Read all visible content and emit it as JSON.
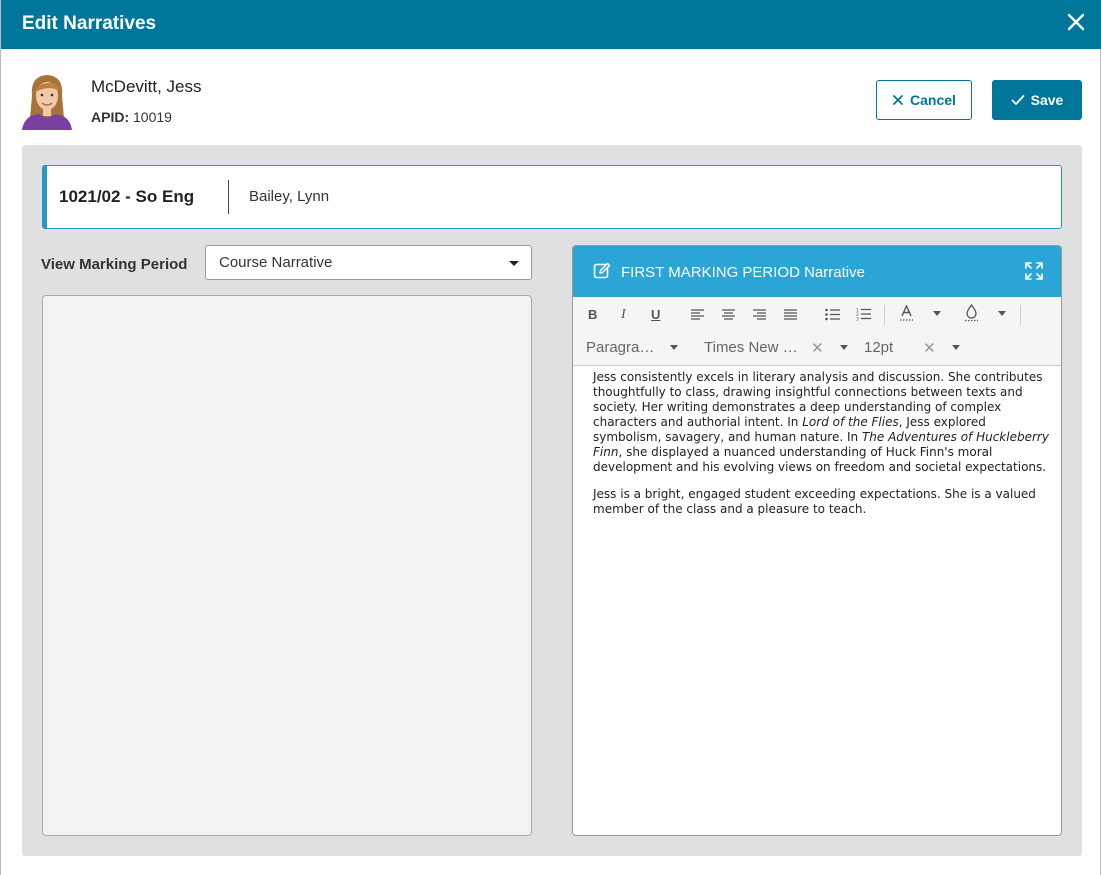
{
  "dialog": {
    "title": "Edit Narratives"
  },
  "student": {
    "name": "McDevitt, Jess",
    "apid_label": "APID:",
    "apid_value": "10019"
  },
  "actions": {
    "cancel_label": "Cancel",
    "save_label": "Save"
  },
  "course": {
    "code": "1021/02 - So Eng",
    "teacher": "Bailey, Lynn"
  },
  "marking_period": {
    "label": "View Marking Period",
    "selected": "Course Narrative"
  },
  "editor": {
    "title": "FIRST MARKING PERIOD Narrative",
    "toolbar": {
      "bold": "B",
      "italic": "I",
      "underline": "U",
      "format": "Paragra…",
      "font": "Times New …",
      "size": "12pt",
      "clear": "✕"
    },
    "p1": {
      "a": "Jess consistently excels in literary analysis and discussion. She contributes thoughtfully to class, drawing insightful connections between texts and society. Her writing demonstrates a deep understanding of complex characters and authorial intent. In ",
      "b": "Lord of the Flies",
      "c": ", Jess explored symbolism, savagery, and human nature. In ",
      "d": "The Adventures of Huckleberry Finn",
      "e": ", she displayed a nuanced understanding of Huck Finn's moral development and his evolving views on freedom and societal expectations."
    },
    "p2": "Jess is a bright, engaged student exceeding expectations. She is a valued member of the class and a pleasure to teach."
  }
}
